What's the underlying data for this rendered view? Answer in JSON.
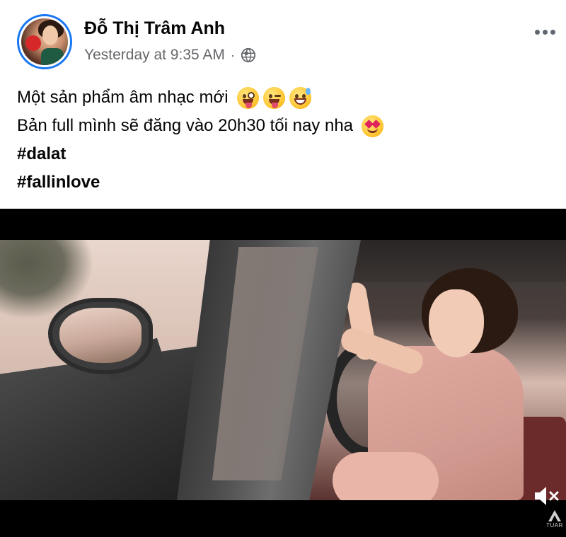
{
  "post": {
    "author": "Đỗ Thị Trâm Anh",
    "timestamp": "Yesterday at 9:35 AM",
    "separator": "·",
    "privacy_icon": "globe-icon",
    "text_line_1": "Một sản phẩm âm nhạc mới",
    "text_line_2": "Bản full mình sẽ đăng vào 20h30 tối nay nha",
    "line_1_emojis": [
      "zany-face-emoji",
      "winking-tongue-face-emoji",
      "grinning-sweat-face-emoji"
    ],
    "line_2_emojis": [
      "heart-eyes-face-emoji"
    ],
    "hashtags": [
      "#dalat",
      "#fallinlove"
    ]
  },
  "video": {
    "mute_icon": "speaker-muted-icon",
    "watermark_text": "TUAR"
  },
  "colors": {
    "accent": "#1877f2",
    "secondary_text": "#65676b",
    "primary_text": "#050505"
  }
}
